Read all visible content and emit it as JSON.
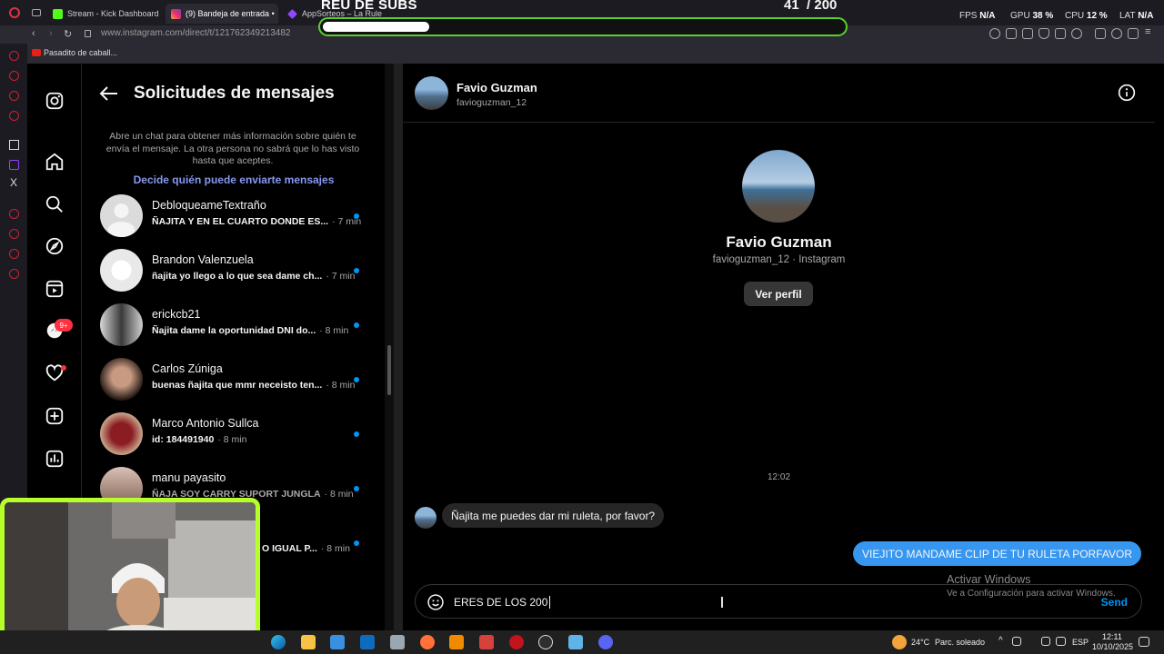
{
  "browser": {
    "tabs": [
      {
        "label": "Stream - Kick Dashboard",
        "color": "#53fc18"
      },
      {
        "label": "(9) Bandeja de entrada •",
        "color": "#e1306c"
      },
      {
        "label": "AppSorteos – La Ruleta",
        "color": "#9146ff"
      }
    ],
    "url": "www.instagram.com/direct/t/121762349213482",
    "bookmark": "Pasadito de caball..."
  },
  "overlay": {
    "title": "REU DE SUBS",
    "count": "41",
    "total": "/ 200",
    "progress": 0.205,
    "stats": [
      {
        "label": "FPS",
        "value": "N/A"
      },
      {
        "label": "GPU",
        "value": "38 %"
      },
      {
        "label": "CPU",
        "value": "12 %"
      },
      {
        "label": "LAT",
        "value": "N/A"
      }
    ]
  },
  "nav": {
    "badge": "9+"
  },
  "requests": {
    "title": "Solicitudes de mensajes",
    "description": "Abre un chat para obtener más información sobre quién te envía el mensaje. La otra persona no sabrá que lo has visto hasta que aceptes.",
    "link": "Decide quién puede enviarte mensajes",
    "items": [
      {
        "name": "DebloqueameTextraño",
        "preview": "ÑAJITA Y EN EL CUARTO DONDE ES...",
        "time": "· 7 min",
        "bold": true
      },
      {
        "name": "Brandon Valenzuela",
        "preview": "ñajita yo llego a lo que sea dame ch...",
        "time": "· 7 min",
        "bold": true
      },
      {
        "name": "erickcb21",
        "preview": "Ñajita dame la oportunidad DNI do...",
        "time": "· 8 min",
        "bold": true
      },
      {
        "name": "Carlos Zúniga",
        "preview": "buenas ñajita que mmr neceisto ten...",
        "time": "· 8 min",
        "bold": true
      },
      {
        "name": "Marco Antonio Sullca",
        "preview": "id: 184491940",
        "time": "· 8 min",
        "bold": true
      },
      {
        "name": "manu payasito",
        "preview": "ÑAJA SOY CARRY SUPORT JUNGLA",
        "time": "· 8 min",
        "bold": true
      },
      {
        "name": "",
        "preview": "O IGUAL P...",
        "time": "· 8 min",
        "bold": true
      }
    ]
  },
  "chat": {
    "name": "Favio Guzman",
    "username": "favioguzman_12",
    "profile_sub": "favioguzman_12 · Instagram",
    "view_profile": "Ver perfil",
    "time": "12:02",
    "incoming": "Ñajita me puedes dar mi ruleta, por favor?",
    "outgoing": "VIEJITO MANDAME CLIP DE TU RULETA PORFAVOR",
    "composer_text": "ERES DE LOS 200",
    "send": "Send"
  },
  "watermark": {
    "line1": "Activar Windows",
    "line2": "Ve a Configuración para activar Windows."
  },
  "taskbar": {
    "weather": "24°C",
    "weather_desc": "Parc. soleado",
    "lang": "ESP",
    "time": "12:11",
    "date": "10/10/2025"
  }
}
